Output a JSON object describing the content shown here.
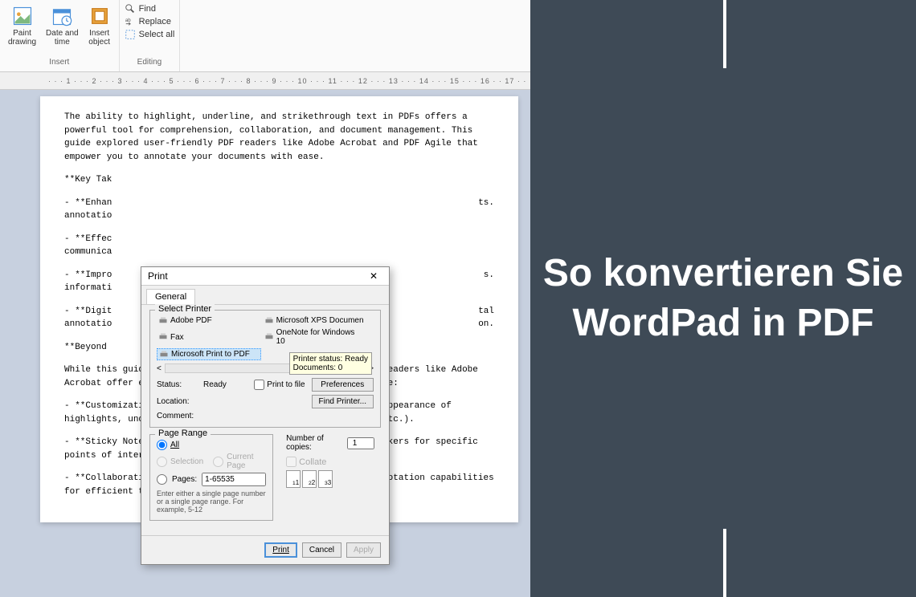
{
  "ribbon": {
    "insert_group": "Insert",
    "editing_group": "Editing",
    "paint_drawing": "Paint\ndrawing",
    "date_time": "Date and\ntime",
    "insert_object": "Insert\nobject",
    "find": "Find",
    "replace": "Replace",
    "select_all": "Select all"
  },
  "ruler": "· · · 1 · · · 2 · · · 3 · · · 4 · · · 5 · · · 6 · · · 7 · · · 8 · · · 9 · · · 10 · · · 11 · · · 12 · · · 13 · · · 14 · · · 15 · · · 16 · · 17 · ·",
  "doc": {
    "p1": "The ability to highlight, underline, and strikethrough text in PDFs offers a powerful tool for comprehension, collaboration, and document management. This guide explored user-friendly PDF readers like Adobe Acrobat and PDF Agile that empower you to annotate your documents with ease.",
    "p2": "**Key Tak",
    "p3": "- **Enhan\nannotatio",
    "p3b": "ts.",
    "p4": "- **Effec\ncommunica",
    "p5": "- **Impro\ninformati",
    "p5b": "s.",
    "p6": "- **Digit\nannotatio",
    "p6b": "tal\non.",
    "p7": "**Beyond",
    "p8": "While this guide focused on core annotation tools, some PDF readers like Adobe Acrobat offer even more advanced features. These might include:",
    "p9": "- **Customization Options:** The ability to personalize the appearance of highlights, underlines, and strikethroughs (color, opacity, etc.).",
    "p10": "- **Sticky Notes and Stamps:** Adding comments and visual markers for specific points of interest.",
    "p11": "- **Collaboration Tools:** Real-time document sharing and annotation capabilities for efficient teamwork."
  },
  "dialog": {
    "title": "Print",
    "tab": "General",
    "select_printer": "Select Printer",
    "printers": {
      "adobe": "Adobe PDF",
      "fax": "Fax",
      "ms_print": "Microsoft Print to PDF",
      "xps": "Microsoft XPS Documen",
      "onenote": "OneNote for Windows 10"
    },
    "tooltip": "Printer status: Ready\nDocuments: 0",
    "status_label": "Status:",
    "status_value": "Ready",
    "location_label": "Location:",
    "comment_label": "Comment:",
    "print_to_file": "Print to file",
    "preferences": "Preferences",
    "find_printer": "Find Printer...",
    "page_range": "Page Range",
    "all": "All",
    "selection": "Selection",
    "current_page": "Current Page",
    "pages": "Pages:",
    "pages_value": "1-65535",
    "hint": "Enter either a single page number or a single page range. For example, 5-12",
    "copies_label": "Number of copies:",
    "copies_value": "1",
    "collate": "Collate",
    "collate_icons": [
      "1",
      "2",
      "3"
    ],
    "btn_print": "Print",
    "btn_cancel": "Cancel",
    "btn_apply": "Apply"
  },
  "banner": "So konvertieren Sie WordPad in PDF"
}
